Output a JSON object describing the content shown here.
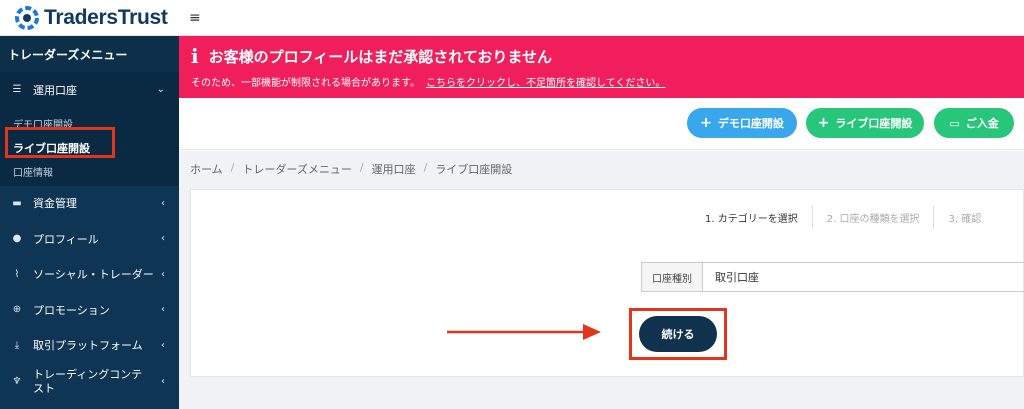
{
  "brand": {
    "name": "TradersTrust"
  },
  "sidebar": {
    "menu_title": "トレーダーズメニュー",
    "account_menu": {
      "label": "運用口座",
      "sub_items": [
        "デモ口座開設",
        "ライブ口座開設",
        "口座情報"
      ]
    },
    "items": [
      {
        "label": "資金管理",
        "icon": "wallet-icon"
      },
      {
        "label": "プロフィール",
        "icon": "user-icon"
      },
      {
        "label": "ソーシャル・トレーダー",
        "icon": "chart-icon"
      },
      {
        "label": "プロモーション",
        "icon": "globe-icon"
      },
      {
        "label": "取引プラットフォーム",
        "icon": "download-icon"
      },
      {
        "label": "トレーディングコンテスト",
        "icon": "trophy-icon"
      }
    ]
  },
  "alert": {
    "icon": "i",
    "title": "お客様のプロフィールはまだ承認されておりません",
    "message": "そのため、一部機能が制限される場合があります。",
    "link": "こちらをクリックし、不足箇所を確認してください。"
  },
  "actions": {
    "demo_label": "デモ口座開設",
    "live_label": "ライブ口座開設",
    "deposit_label": "ご入金"
  },
  "breadcrumb": [
    "ホーム",
    "トレーダーズメニュー",
    "運用口座",
    "ライブ口座開設"
  ],
  "steps": [
    "1. カテゴリーを選択",
    "2. 口座の種類を選択",
    "3. 確認"
  ],
  "form": {
    "label": "口座種別",
    "value": "取引口座"
  },
  "continue_label": "続ける",
  "colors": {
    "sidebar": "#0e3553",
    "alert": "#f01f5c",
    "highlight": "#e2351d",
    "blue_button": "#39a7ec",
    "green_button": "#27c67a"
  }
}
